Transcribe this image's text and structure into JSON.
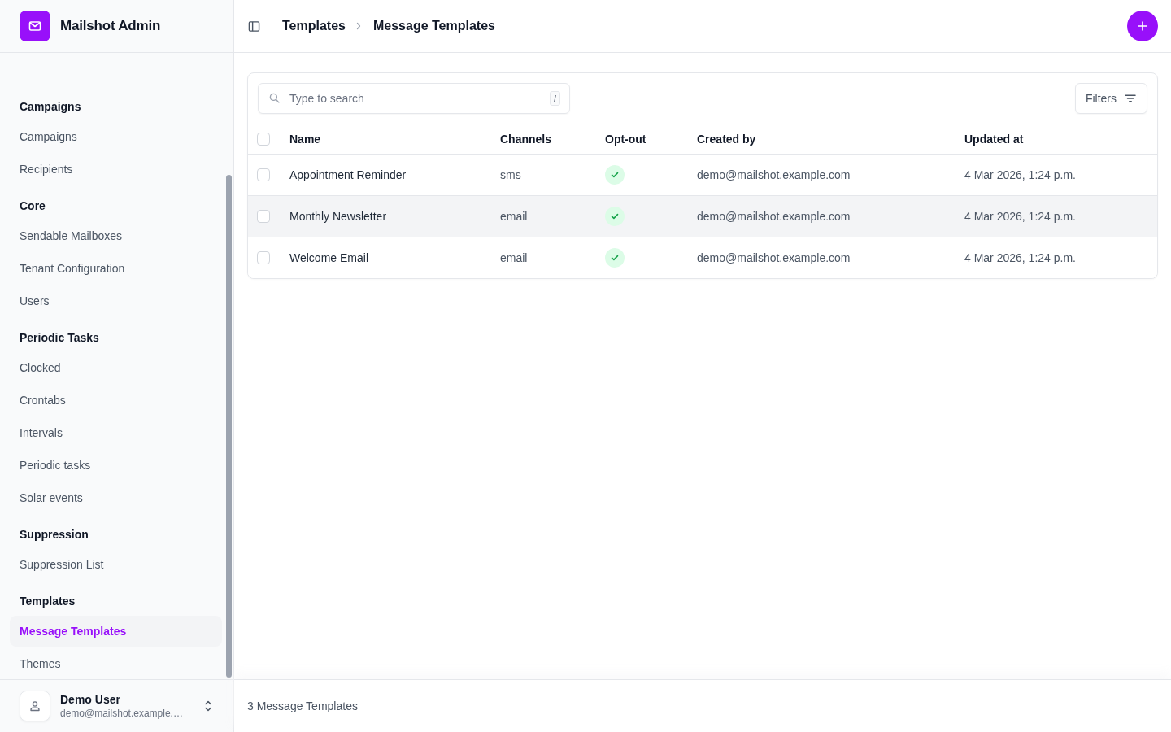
{
  "app": {
    "title": "Mailshot Admin"
  },
  "sidebar": {
    "sections": [
      {
        "heading": "Campaigns",
        "items": [
          {
            "label": "Campaigns",
            "selected": false
          },
          {
            "label": "Recipients",
            "selected": false
          }
        ]
      },
      {
        "heading": "Core",
        "items": [
          {
            "label": "Sendable Mailboxes",
            "selected": false
          },
          {
            "label": "Tenant Configuration",
            "selected": false
          },
          {
            "label": "Users",
            "selected": false
          }
        ]
      },
      {
        "heading": "Periodic Tasks",
        "items": [
          {
            "label": "Clocked",
            "selected": false
          },
          {
            "label": "Crontabs",
            "selected": false
          },
          {
            "label": "Intervals",
            "selected": false
          },
          {
            "label": "Periodic tasks",
            "selected": false
          },
          {
            "label": "Solar events",
            "selected": false
          }
        ]
      },
      {
        "heading": "Suppression",
        "items": [
          {
            "label": "Suppression List",
            "selected": false
          }
        ]
      },
      {
        "heading": "Templates",
        "items": [
          {
            "label": "Message Templates",
            "selected": true
          },
          {
            "label": "Themes",
            "selected": false
          }
        ]
      }
    ]
  },
  "user": {
    "name": "Demo User",
    "email": "demo@mailshot.example.…"
  },
  "header": {
    "breadcrumbs": [
      "Templates",
      "Message Templates"
    ]
  },
  "toolbar": {
    "search": {
      "placeholder": "Type to search",
      "shortcut": "/"
    },
    "filters": "Filters"
  },
  "table": {
    "all_checked": false,
    "columns": [
      "Name",
      "Channels",
      "Opt-out",
      "Created by",
      "Updated at"
    ],
    "rows": [
      {
        "name": "Appointment Reminder",
        "channels": "sms",
        "opt_out": true,
        "created_by": "demo@mailshot.example.com",
        "updated_at": "4 Mar 2026, 1:24 p.m.",
        "checked": false,
        "highlighted": false
      },
      {
        "name": "Monthly Newsletter",
        "channels": "email",
        "opt_out": true,
        "created_by": "demo@mailshot.example.com",
        "updated_at": "4 Mar 2026, 1:24 p.m.",
        "checked": false,
        "highlighted": true
      },
      {
        "name": "Welcome Email",
        "channels": "email",
        "opt_out": true,
        "created_by": "demo@mailshot.example.com",
        "updated_at": "4 Mar 2026, 1:24 p.m.",
        "checked": false,
        "highlighted": false
      }
    ]
  },
  "footer": {
    "count": "3 Message Templates"
  }
}
